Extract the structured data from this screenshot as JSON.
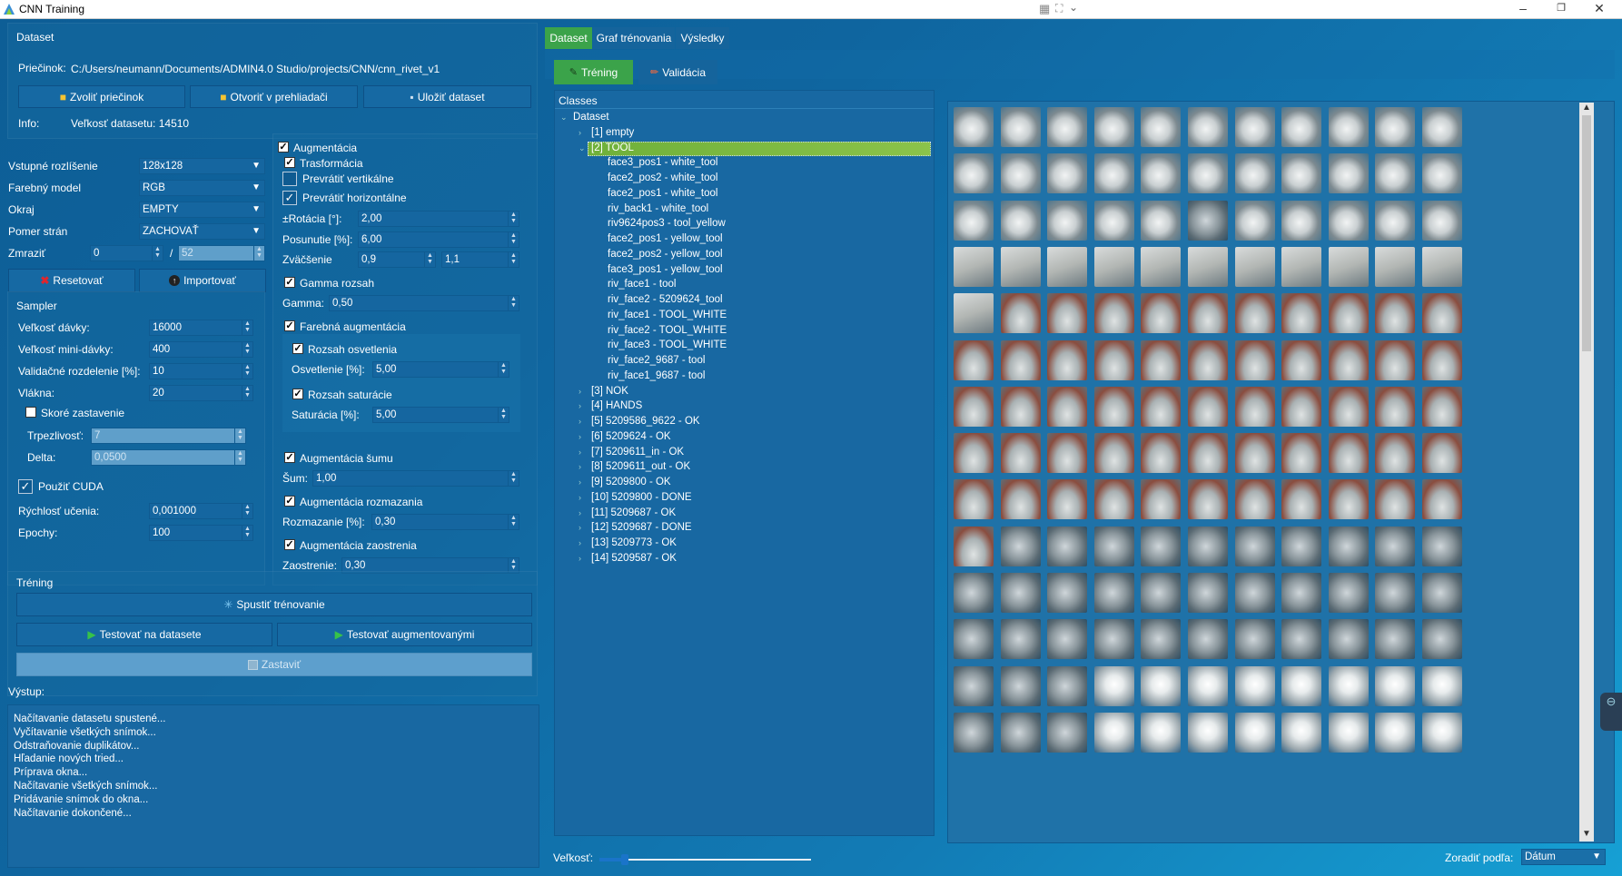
{
  "window": {
    "title": "CNN Training"
  },
  "dataset_panel": {
    "heading": "Dataset",
    "folder_label": "Priečinok:",
    "folder_path": "C:/Users/neumann/Documents/ADMIN4.0 Studio/projects/CNN/cnn_rivet_v1",
    "btn_choose_folder": "Zvoliť priečinok",
    "btn_open_browser": "Otvoriť v prehliadači",
    "btn_save_dataset": "Uložiť dataset",
    "info_label": "Info:",
    "info_value": "Veľkosť datasetu: 14510"
  },
  "input_settings": {
    "resolution_label": "Vstupné rozlíšenie",
    "resolution_value": "128x128",
    "color_model_label": "Farebný model",
    "color_model_value": "RGB",
    "border_label": "Okraj",
    "border_value": "EMPTY",
    "aspect_label": "Pomer strán",
    "aspect_value": "ZACHOVAŤ",
    "freeze_label": "Zmraziť",
    "freeze_value": "0",
    "freeze_sep": "/",
    "freeze_max": "52",
    "btn_reset": "Resetovať",
    "btn_import": "Importovať"
  },
  "augmentation": {
    "augment_label": "Augmentácia",
    "transform_label": "Trasformácia",
    "flip_v_label": "Prevrátiť vertikálne",
    "flip_h_label": "Prevrátiť horizontálne",
    "rotation_label": "±Rotácia [°]:",
    "rotation_value": "2,00",
    "shift_label": "Posunutie [%]:",
    "shift_value": "6,00",
    "zoom_label": "Zväčšenie",
    "zoom_min": "0,9",
    "zoom_max": "1,1",
    "gamma_range_label": "Gamma rozsah",
    "gamma_label": "Gamma:",
    "gamma_value": "0,50",
    "color_aug_label": "Farebná augmentácia",
    "light_range_label": "Rozsah osvetlenia",
    "light_label": "Osvetlenie [%]:",
    "light_value": "5,00",
    "sat_range_label": "Rozsah saturácie",
    "sat_label": "Saturácia [%]:",
    "sat_value": "5,00",
    "noise_aug_label": "Augmentácia šumu",
    "noise_label": "Šum:",
    "noise_value": "1,00",
    "blur_aug_label": "Augmentácia rozmazania",
    "blur_label": "Rozmazanie [%]:",
    "blur_value": "0,30",
    "sharp_aug_label": "Augmentácia zaostrenia",
    "sharp_label": "Zaostrenie:",
    "sharp_value": "0,30"
  },
  "sampler": {
    "heading": "Sampler",
    "batch_label": "Veľkosť dávky:",
    "batch_value": "16000",
    "minibatch_label": "Veľkosť mini-dávky:",
    "minibatch_value": "400",
    "valsplit_label": "Validačné rozdelenie [%]:",
    "valsplit_value": "10",
    "threads_label": "Vlákna:",
    "threads_value": "20",
    "early_stop_label": "Skoré zastavenie",
    "patience_label": "Trpezlivosť:",
    "patience_value": "7",
    "delta_label": "Delta:",
    "delta_value": "0,0500",
    "cuda_label": "Použiť CUDA",
    "lr_label": "Rýchlosť učenia:",
    "lr_value": "0,001000",
    "epochs_label": "Epochy:",
    "epochs_value": "100"
  },
  "training": {
    "heading": "Tréning",
    "btn_start": "Spustiť trénovanie",
    "btn_test_dataset": "Testovať na datasete",
    "btn_test_aug": "Testovať augmentovanými",
    "btn_stop": "Zastaviť"
  },
  "output": {
    "heading": "Výstup:",
    "lines": [
      "Načítavanie datasetu spustené...",
      "Vyčítavanie všetkých snímok...",
      "Odstraňovanie duplikátov...",
      "Hľadanie nových tried...",
      "Príprava okna...",
      "Načítavanie všetkých snímok...",
      "Pridávanie snímok do okna...",
      "Načítavanie dokončené..."
    ]
  },
  "main_tabs": [
    "Dataset",
    "Graf trénovania",
    "Výsledky"
  ],
  "sub_tabs": {
    "training": "Tréning",
    "validation": "Validácia"
  },
  "tree": {
    "header": "Classes",
    "root": "Dataset",
    "nodes": [
      {
        "label": "[1] empty",
        "level": 1,
        "expand": "collapsed",
        "selected": false
      },
      {
        "label": "[2] TOOL",
        "level": 1,
        "expand": "expanded",
        "selected": true
      },
      {
        "label": "face3_pos1 - white_tool",
        "level": 2
      },
      {
        "label": "face2_pos2 - white_tool",
        "level": 2
      },
      {
        "label": "face2_pos1 - white_tool",
        "level": 2
      },
      {
        "label": "riv_back1 - white_tool",
        "level": 2
      },
      {
        "label": "riv9624pos3 - tool_yellow",
        "level": 2
      },
      {
        "label": "face2_pos1 - yellow_tool",
        "level": 2
      },
      {
        "label": "face2_pos2 - yellow_tool",
        "level": 2
      },
      {
        "label": "face3_pos1 - yellow_tool",
        "level": 2
      },
      {
        "label": "riv_face1 - tool",
        "level": 2
      },
      {
        "label": "riv_face2 - 5209624_tool",
        "level": 2
      },
      {
        "label": "riv_face1 - TOOL_WHITE",
        "level": 2
      },
      {
        "label": "riv_face2 - TOOL_WHITE",
        "level": 2
      },
      {
        "label": "riv_face3 - TOOL_WHITE",
        "level": 2
      },
      {
        "label": "riv_face2_9687 - tool",
        "level": 2
      },
      {
        "label": "riv_face1_9687 - tool",
        "level": 2
      },
      {
        "label": "[3] NOK",
        "level": 1,
        "expand": "collapsed"
      },
      {
        "label": "[4] HANDS",
        "level": 1,
        "expand": "collapsed"
      },
      {
        "label": "[5] 5209586_9622 - OK",
        "level": 1,
        "expand": "collapsed"
      },
      {
        "label": "[6] 5209624 - OK",
        "level": 1,
        "expand": "collapsed"
      },
      {
        "label": "[7] 5209611_in - OK",
        "level": 1,
        "expand": "collapsed"
      },
      {
        "label": "[8] 5209611_out - OK",
        "level": 1,
        "expand": "collapsed"
      },
      {
        "label": "[9] 5209800 - OK",
        "level": 1,
        "expand": "collapsed"
      },
      {
        "label": "[10] 5209800 - DONE",
        "level": 1,
        "expand": "collapsed"
      },
      {
        "label": "[11] 5209687 - OK",
        "level": 1,
        "expand": "collapsed"
      },
      {
        "label": "[12] 5209687 - DONE",
        "level": 1,
        "expand": "collapsed"
      },
      {
        "label": "[13] 5209773 - OK",
        "level": 1,
        "expand": "collapsed"
      },
      {
        "label": "[14] 5209587 - OK",
        "level": 1,
        "expand": "collapsed"
      }
    ]
  },
  "thumbnail_grid": {
    "columns": 11,
    "rows": [
      "AAAAAAAAAAA",
      "AAAAAAAAAAA",
      "AAAAAEAAAAA",
      "DDDDDDDDDDD",
      "DBBBBBBBBBB",
      "BBBBBBBBBBB",
      "BBBBBBBBBBB",
      "BBBBBBBBBBB",
      "BBBBBBBBBBB",
      "BEEEEEEEEEE",
      "EEEEEEEEEEE",
      "EEEEEEEEEEE",
      "EEECCCCCCCC",
      "EEECCCCCCCC"
    ]
  },
  "footer": {
    "size_label": "Veľkosť:",
    "size_slider_value": 0.12,
    "sort_label": "Zoradiť podľa:",
    "sort_value": "Dátum"
  },
  "colors": {
    "accent_green": "#3ba34a",
    "selected_tree": "#7dbb3a",
    "bg_blue": "#0e5f97"
  }
}
